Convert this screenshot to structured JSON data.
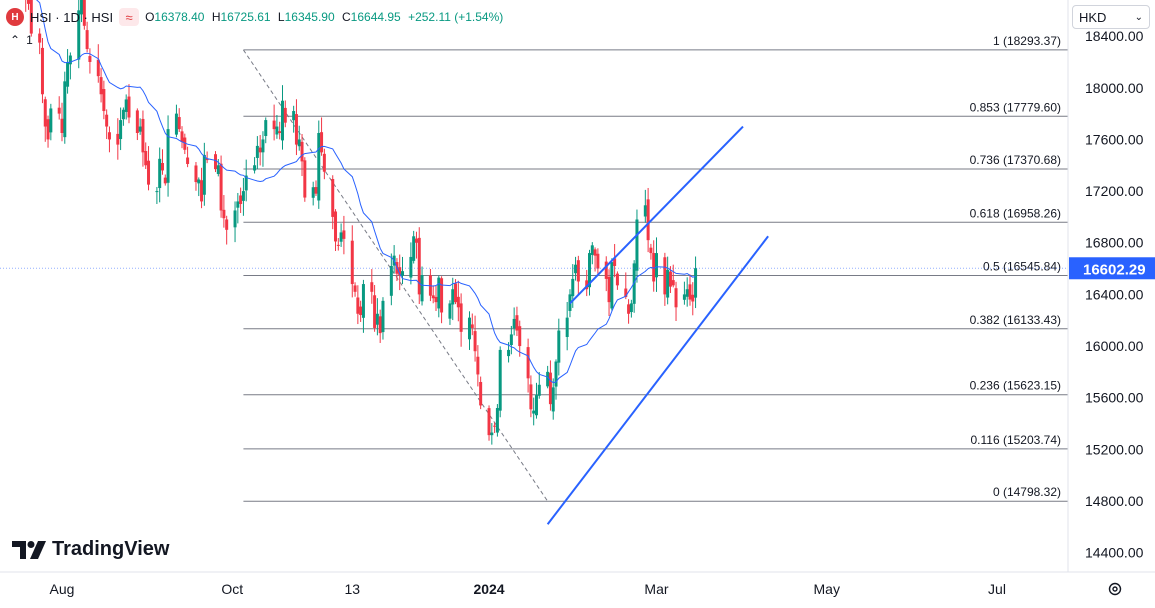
{
  "header": {
    "symbol_badge": "HSI",
    "symbol_text": "HSI · 1D · HSI",
    "indicator_icon": "wave-icon",
    "open_label": "O",
    "open": "16378.40",
    "high_label": "H",
    "high": "16725.61",
    "low_label": "L",
    "low": "16345.90",
    "close_label": "C",
    "close": "16644.95",
    "change": "+252.11 (+1.54%)",
    "collapse_count": "1"
  },
  "currency": {
    "label": "HKD"
  },
  "brand": {
    "name": "TradingView"
  },
  "colors": {
    "up": "#089981",
    "down": "#f23645",
    "ma": "#2962ff",
    "channel": "#2962ff",
    "fib": "#787b86",
    "price_tag": "#2962ff"
  },
  "chart_data": {
    "type": "candlestick",
    "ylim": [
      14250,
      18680
    ],
    "y_ticks": [
      "18400.00",
      "18000.00",
      "17600.00",
      "17200.00",
      "16800.00",
      "16400.00",
      "16000.00",
      "15600.00",
      "15200.00",
      "14800.00",
      "14400.00"
    ],
    "x_ticks": [
      "Aug",
      "Oct",
      "13",
      "2024",
      "Mar",
      "May",
      "Jul"
    ],
    "x_tick_dates": [
      "2023-08-01",
      "2023-10-01",
      "2023-11-13",
      "2024-01-01",
      "2024-03-01",
      "2024-05-01",
      "2024-07-01"
    ],
    "last_price": "16602.29",
    "fib_levels": [
      {
        "ratio": "1",
        "value": 18293.37,
        "label": "1 (18293.37)"
      },
      {
        "ratio": "0.853",
        "value": 17779.6,
        "label": "0.853 (17779.60)"
      },
      {
        "ratio": "0.736",
        "value": 17370.68,
        "label": "0.736 (17370.68)"
      },
      {
        "ratio": "0.618",
        "value": 16958.26,
        "label": "0.618 (16958.26)"
      },
      {
        "ratio": "0.5",
        "value": 16545.84,
        "label": "0.5 (16545.84)"
      },
      {
        "ratio": "0.382",
        "value": 16133.43,
        "label": "0.382 (16133.43)"
      },
      {
        "ratio": "0.236",
        "value": 15623.15,
        "label": "0.236 (15623.15)"
      },
      {
        "ratio": "0.116",
        "value": 15203.74,
        "label": "0.116 (15203.74)"
      },
      {
        "ratio": "0",
        "value": 14798.32,
        "label": "0 (14798.32)"
      }
    ],
    "fib_start_date": "2023-10-05",
    "fib_end_date": "2024-01-22",
    "channel_upper": [
      [
        "2024-01-30",
        16330
      ],
      [
        "2024-04-01",
        17700
      ]
    ],
    "channel_lower": [
      [
        "2024-01-22",
        14620
      ],
      [
        "2024-04-10",
        16850
      ]
    ],
    "candle_dates_start": "2023-07-17",
    "closes": [
      18850,
      18980,
      18700,
      18650,
      18420,
      18350,
      17950,
      17700,
      17600,
      17840,
      17800,
      17650,
      18050,
      18200,
      18250,
      18600,
      18700,
      18480,
      18300,
      18200,
      18090,
      17950,
      17820,
      17700,
      17600,
      17560,
      17750,
      17830,
      17910,
      17770,
      17650,
      17700,
      17500,
      17400,
      17250,
      17200,
      17450,
      17360,
      17260,
      17680,
      17800,
      17680,
      17580,
      17520,
      17410,
      17270,
      17290,
      17120,
      17480,
      17440,
      17370,
      17400,
      17050,
      16990,
      16900,
      17050,
      17120,
      17100,
      17200,
      17320,
      17400,
      17550,
      17500,
      17600,
      17750,
      17680,
      17700,
      17650,
      17900,
      17730,
      17820,
      17560,
      17600,
      17430,
      17150,
      17230,
      17180,
      17650,
      17500,
      17350,
      17000,
      16810,
      16780,
      16880,
      16830,
      16480,
      16420,
      16250,
      16240,
      16480,
      16420,
      16140,
      16250,
      16100,
      16350,
      16620,
      16700,
      16560,
      16550,
      16580,
      16690,
      16850,
      16800,
      16400,
      16550,
      16390,
      16370,
      16340,
      16530,
      16260,
      16330,
      16440,
      16340,
      16300,
      16110,
      16220,
      16140,
      15960,
      15780,
      15540,
      15310,
      15330,
      15380,
      15520,
      15970,
      15970,
      16090,
      16210,
      16120,
      16000,
      15750,
      15510,
      15500,
      15620,
      15700,
      15800,
      15550,
      15680,
      15880,
      16120,
      16220,
      16400,
      16520,
      16630,
      16500,
      16440,
      16720,
      16780,
      16700,
      16600,
      16520,
      16340,
      16650,
      16620,
      16470,
      16380,
      16250,
      16330,
      16640,
      16980,
      17090,
      16820,
      16720,
      16500,
      16720,
      16400,
      16590,
      16460,
      16470,
      16300,
      16400,
      16440,
      16360,
      16345,
      16603
    ],
    "ma_period": 20
  }
}
